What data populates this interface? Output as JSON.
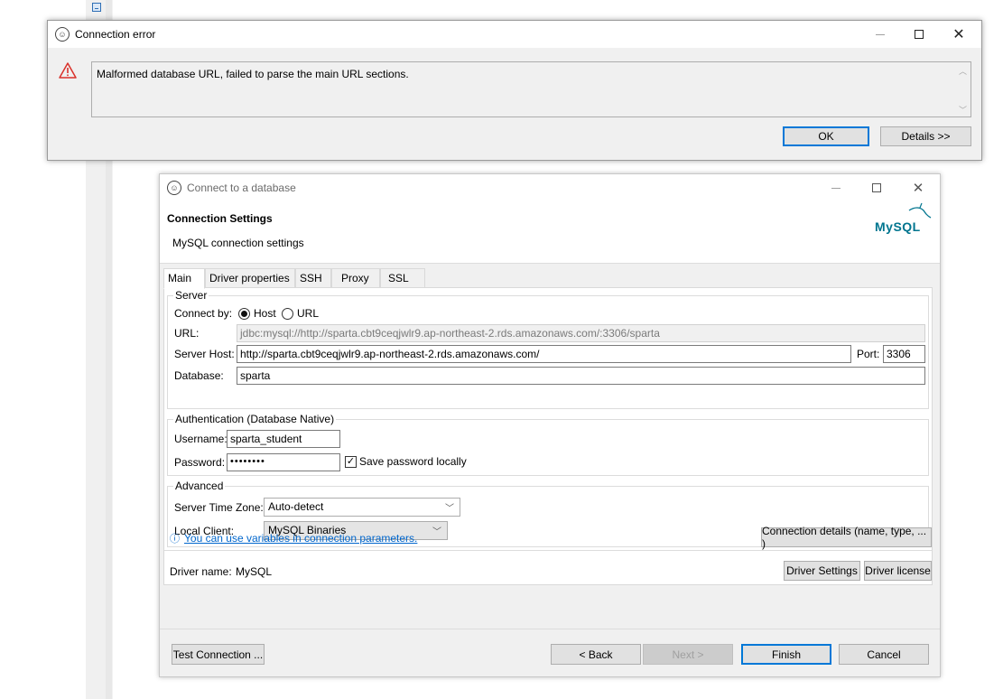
{
  "error_dialog": {
    "title": "Connection error",
    "message": "Malformed database URL, failed to parse the main URL sections.",
    "ok_label": "OK",
    "details_label": "Details >>",
    "warning_icon": "warning-triangle-icon",
    "warning_color": "#d9312b"
  },
  "connect_dialog": {
    "title": "Connect to a database",
    "header_title": "Connection Settings",
    "header_subtitle": "MySQL connection settings",
    "logo_text": "MySQL",
    "logo_color": "#00758f",
    "logo_accent": "#f29111",
    "tabs": [
      "Main",
      "Driver properties",
      "SSH",
      "Proxy",
      "SSL"
    ],
    "active_tab": "Main",
    "server": {
      "group_title": "Server",
      "connect_by_label": "Connect by:",
      "host_option": "Host",
      "url_option": "URL",
      "selected": "Host",
      "url_label": "URL:",
      "url_value": "jdbc:mysql://http://sparta.cbt9ceqjwlr9.ap-northeast-2.rds.amazonaws.com/:3306/sparta",
      "host_label": "Server Host:",
      "host_value": "http://sparta.cbt9ceqjwlr9.ap-northeast-2.rds.amazonaws.com/",
      "port_label": "Port:",
      "port_value": "3306",
      "database_label": "Database:",
      "database_value": "sparta"
    },
    "auth": {
      "group_title": "Authentication (Database Native)",
      "username_label": "Username:",
      "username_value": "sparta_student",
      "password_label": "Password:",
      "password_value": "••••••••",
      "save_password_label": "Save password locally",
      "save_password_checked": true
    },
    "advanced": {
      "group_title": "Advanced",
      "timezone_label": "Server Time Zone:",
      "timezone_value": "Auto-detect",
      "local_client_label": "Local Client:",
      "local_client_value": "MySQL Binaries"
    },
    "variables_link": "You can use variables in connection parameters.",
    "connection_details_label": "Connection details (name, type, ... )",
    "driver_name_label": "Driver name:",
    "driver_name_value": "MySQL",
    "driver_settings_label": "Driver Settings",
    "driver_license_label": "Driver license",
    "footer": {
      "test_label": "Test Connection ...",
      "back_label": "< Back",
      "next_label": "Next >",
      "finish_label": "Finish",
      "cancel_label": "Cancel"
    }
  }
}
